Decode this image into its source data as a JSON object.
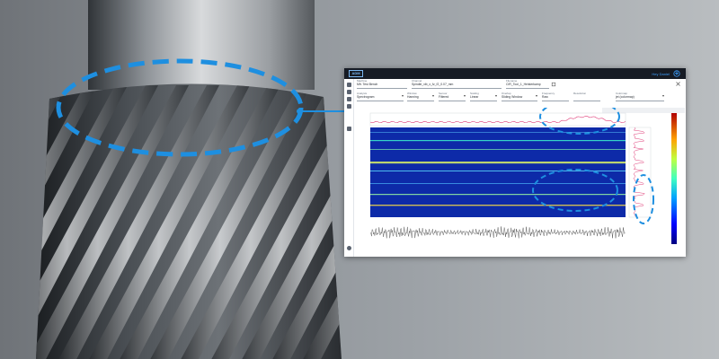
{
  "app": {
    "name": "ADM",
    "user_link": "Hey Daniel",
    "form": {
      "row1": [
        {
          "label": "Machine",
          "value": "Mfr. Test Bench"
        },
        {
          "label": "Channel",
          "value": "Spindle_vib_x_fz_f2_0.07_mm"
        },
        {
          "label": "Filename",
          "value": "CIR_Tool_1_Heisterkamp"
        }
      ],
      "row2": [
        {
          "label": "Analysis",
          "value": "Spectrogram"
        },
        {
          "label": "Window",
          "value": "Hanning"
        },
        {
          "label": "Sensor",
          "value": "Filtered"
        },
        {
          "label": "Scaling",
          "value": "Linear"
        },
        {
          "label": "Overlap",
          "value": "Sliding Window"
        },
        {
          "label": "Frequency",
          "value": "Raw"
        },
        {
          "label": "Resolution",
          "value": ""
        },
        {
          "label": "Colormap",
          "value": "jet (colormap)"
        }
      ]
    }
  },
  "colors": {
    "accent": "#1e8fe0",
    "topbar": "#161b24",
    "marginal_line": "#e0407a"
  },
  "icons": [
    "logout-icon",
    "sidebar-icons",
    "settings-icon"
  ]
}
